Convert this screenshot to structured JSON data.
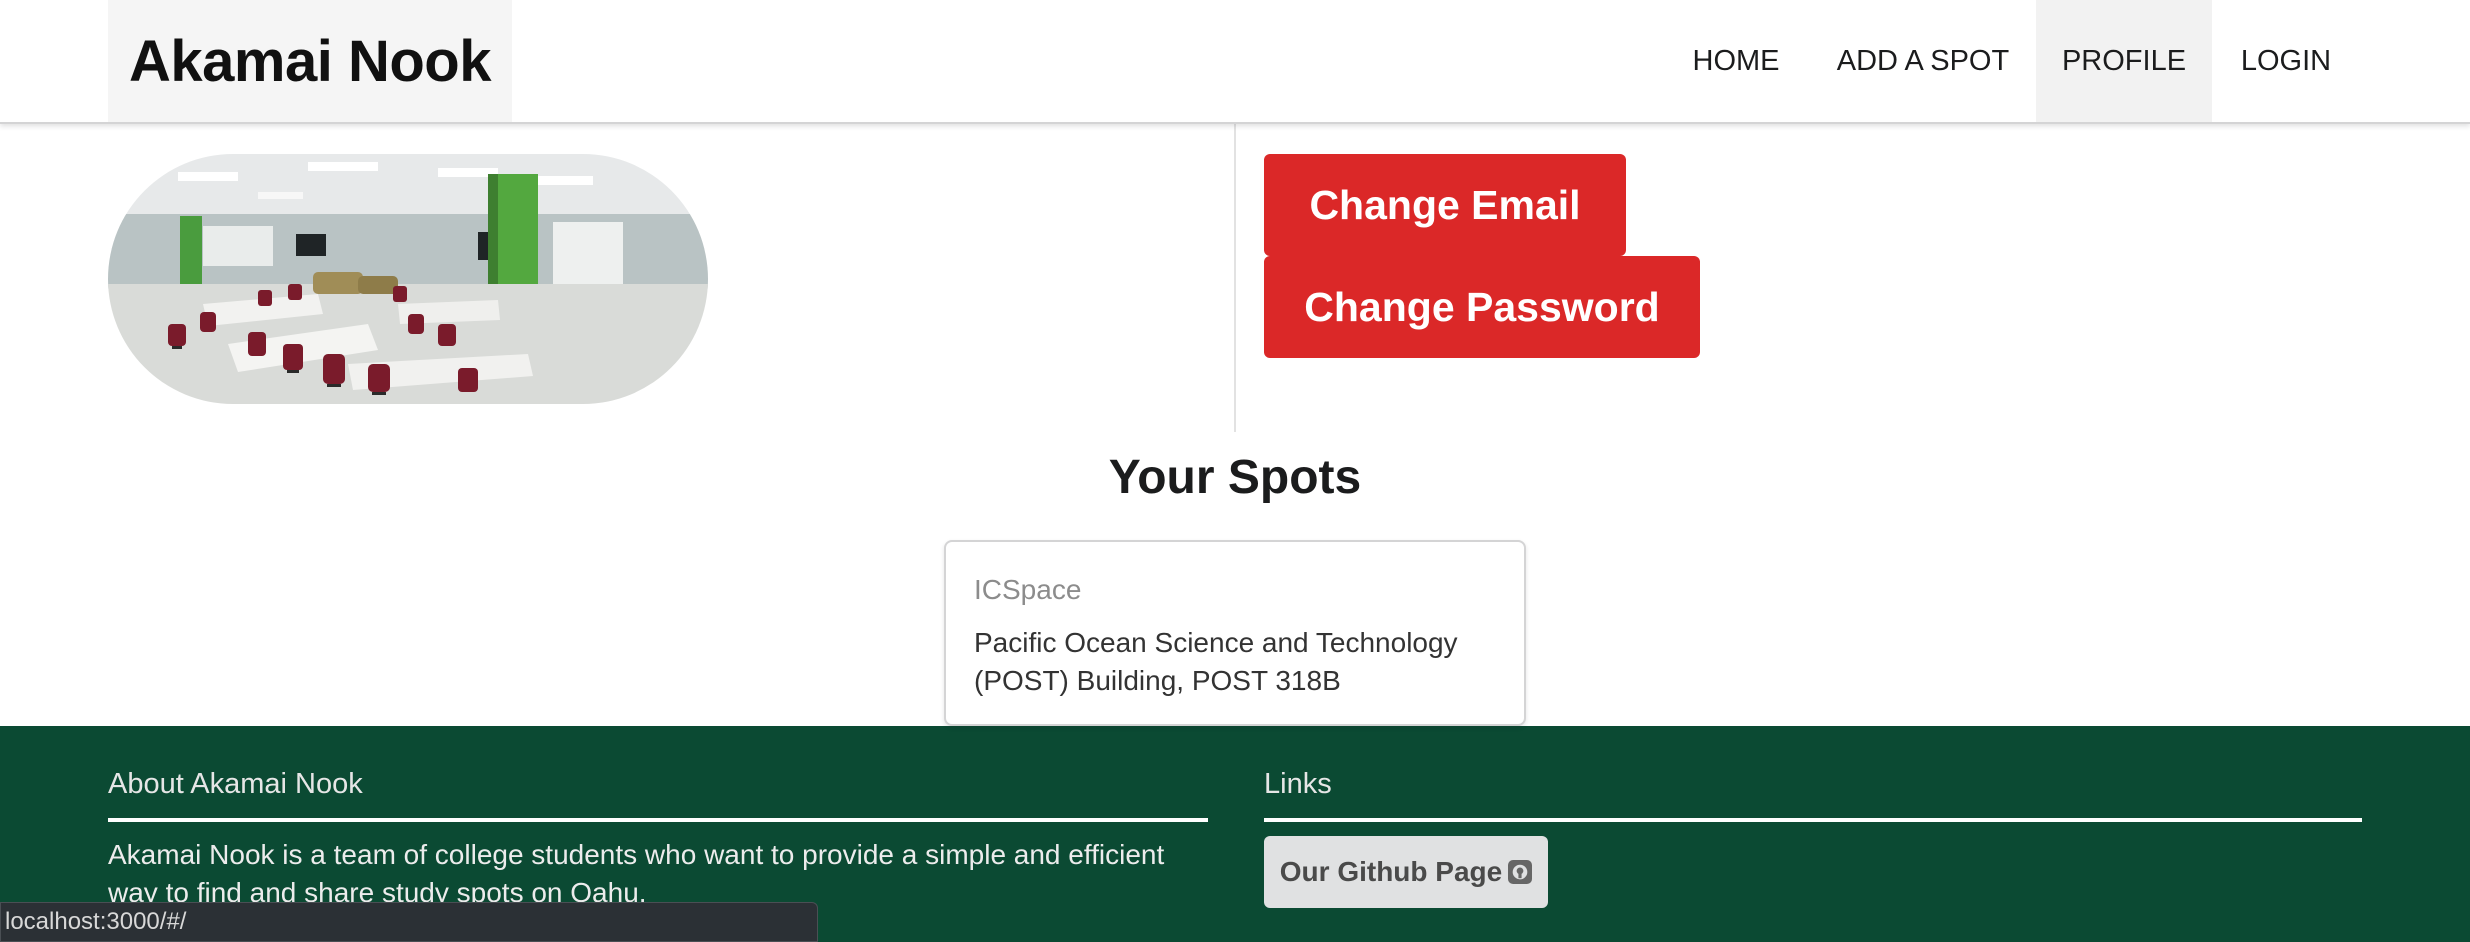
{
  "header": {
    "brand": "Akamai Nook",
    "nav": {
      "home": "HOME",
      "add_spot": "ADD A SPOT",
      "profile": "PROFILE",
      "login": "LOGIN"
    },
    "active_item": "PROFILE"
  },
  "profile": {
    "change_email_label": "Change Email",
    "change_password_label": "Change Password"
  },
  "spots": {
    "title": "Your Spots",
    "items": [
      {
        "name": "ICSpace",
        "location": "Pacific Ocean Science and Technology (POST) Building, POST 318B"
      }
    ]
  },
  "footer": {
    "about_heading": "About Akamai Nook",
    "about_text": "Akamai Nook is a team of college students who want to provide a simple and efficient way to find and share study spots on Oahu.",
    "links_heading": "Links",
    "github_label": "Our Github Page"
  },
  "status_url": "localhost:3000/#/",
  "colors": {
    "accent_red": "#db2828",
    "footer_green": "#0b4a33",
    "active_nav_bg": "#f2f2f2"
  }
}
